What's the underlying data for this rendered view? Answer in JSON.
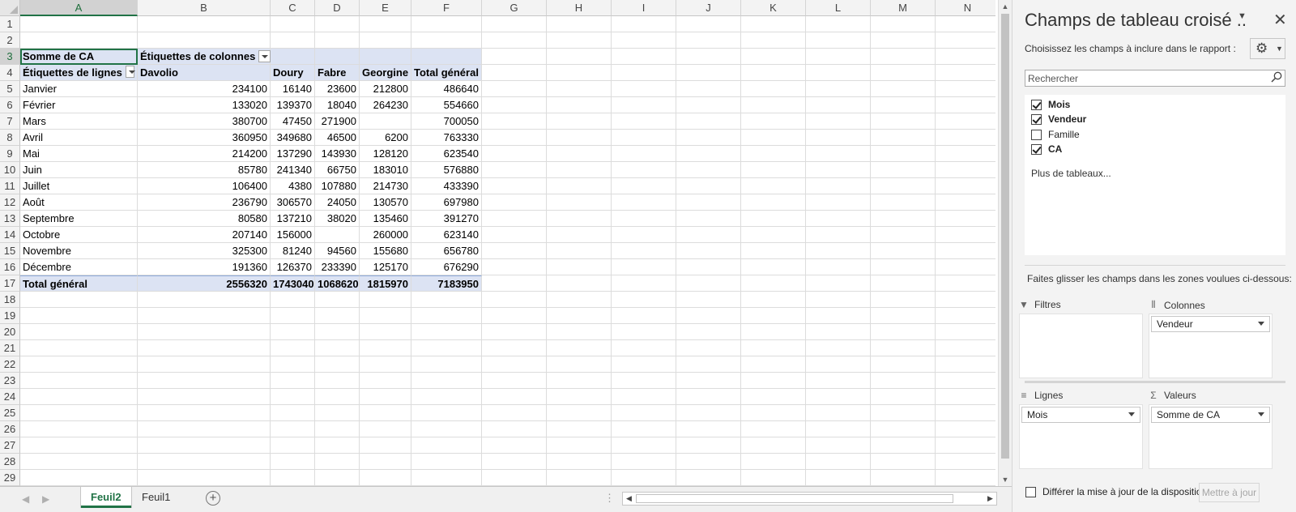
{
  "columns": [
    "A",
    "B",
    "C",
    "D",
    "E",
    "F",
    "G",
    "H",
    "I",
    "J",
    "K",
    "L",
    "M",
    "N"
  ],
  "rows": [
    "1",
    "2",
    "3",
    "4",
    "5",
    "6",
    "7",
    "8",
    "9",
    "10",
    "11",
    "12",
    "13",
    "14",
    "15",
    "16",
    "17",
    "18",
    "19",
    "20",
    "21",
    "22",
    "23",
    "24",
    "25",
    "26",
    "27",
    "28",
    "29"
  ],
  "pivot": {
    "value_label": "Somme de CA",
    "col_labels": "Étiquettes de colonnes",
    "row_labels": "Étiquettes de lignes",
    "sellers": [
      "Davolio",
      "Doury",
      "Fabre",
      "Georgine"
    ],
    "grand_total_header": "Total général",
    "months": [
      {
        "name": "Janvier",
        "vals": [
          "234100",
          "16140",
          "23600",
          "212800"
        ],
        "total": "486640"
      },
      {
        "name": "Février",
        "vals": [
          "133020",
          "139370",
          "18040",
          "264230"
        ],
        "total": "554660"
      },
      {
        "name": "Mars",
        "vals": [
          "380700",
          "47450",
          "271900",
          ""
        ],
        "total": "700050"
      },
      {
        "name": "Avril",
        "vals": [
          "360950",
          "349680",
          "46500",
          "6200"
        ],
        "total": "763330"
      },
      {
        "name": "Mai",
        "vals": [
          "214200",
          "137290",
          "143930",
          "128120"
        ],
        "total": "623540"
      },
      {
        "name": "Juin",
        "vals": [
          "85780",
          "241340",
          "66750",
          "183010"
        ],
        "total": "576880"
      },
      {
        "name": "Juillet",
        "vals": [
          "106400",
          "4380",
          "107880",
          "214730"
        ],
        "total": "433390"
      },
      {
        "name": "Août",
        "vals": [
          "236790",
          "306570",
          "24050",
          "130570"
        ],
        "total": "697980"
      },
      {
        "name": "Septembre",
        "vals": [
          "80580",
          "137210",
          "38020",
          "135460"
        ],
        "total": "391270"
      },
      {
        "name": "Octobre",
        "vals": [
          "207140",
          "156000",
          "",
          "260000"
        ],
        "total": "623140"
      },
      {
        "name": "Novembre",
        "vals": [
          "325300",
          "81240",
          "94560",
          "155680"
        ],
        "total": "656780"
      },
      {
        "name": "Décembre",
        "vals": [
          "191360",
          "126370",
          "233390",
          "125170"
        ],
        "total": "676290"
      }
    ],
    "grand_total_row": {
      "label": "Total général",
      "vals": [
        "2556320",
        "1743040",
        "1068620",
        "1815970"
      ],
      "total": "7183950"
    }
  },
  "sheets": {
    "active": "Feuil2",
    "other": "Feuil1"
  },
  "panel": {
    "title": "Champs de tableau croisé ..",
    "subtitle": "Choisissez les champs à inclure dans le rapport :",
    "search_placeholder": "Rechercher",
    "fields": [
      {
        "name": "Mois",
        "checked": true
      },
      {
        "name": "Vendeur",
        "checked": true
      },
      {
        "name": "Famille",
        "checked": false
      },
      {
        "name": "CA",
        "checked": true
      }
    ],
    "more_tables": "Plus de tableaux...",
    "drag_text": "Faites glisser les champs dans les zones voulues ci-dessous:",
    "zones": {
      "filters": {
        "label": "Filtres",
        "items": []
      },
      "columns": {
        "label": "Colonnes",
        "items": [
          "Vendeur"
        ]
      },
      "rows": {
        "label": "Lignes",
        "items": [
          "Mois"
        ]
      },
      "values": {
        "label": "Valeurs",
        "items": [
          "Somme de CA"
        ]
      }
    },
    "defer_label": "Différer la mise à jour de la disposition",
    "update_button": "Mettre à jour"
  },
  "colors": {
    "accent": "#217346",
    "pivot_header": "#dce3f3"
  }
}
